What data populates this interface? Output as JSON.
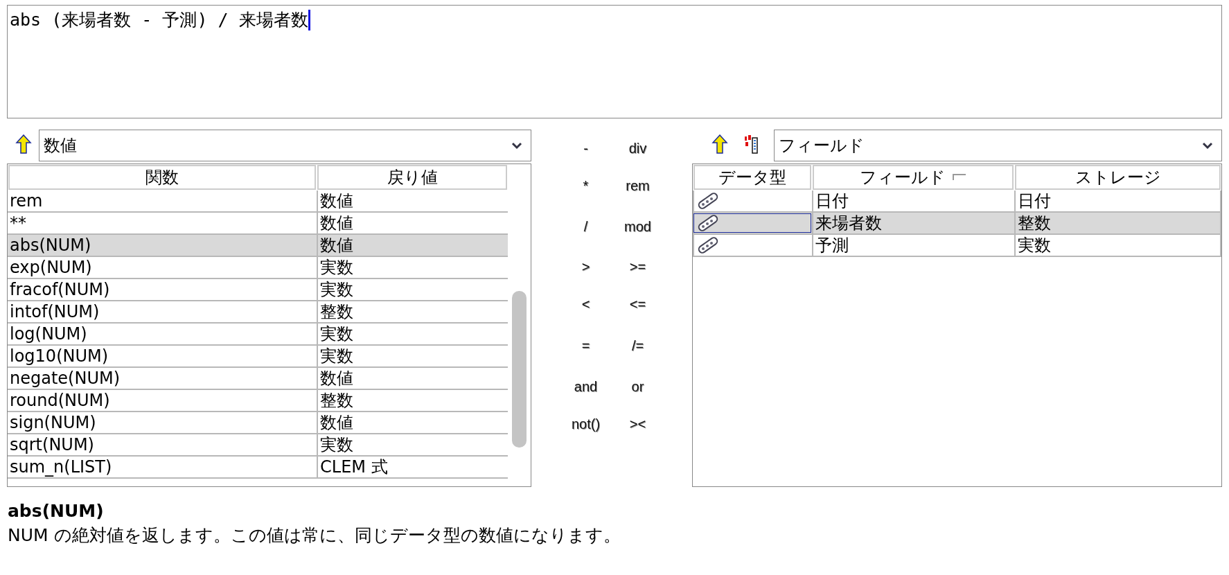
{
  "expression": {
    "value": "abs (来場者数 - 予測) / 来場者数"
  },
  "function_panel": {
    "category": {
      "value": "数値"
    },
    "columns": [
      "関数",
      "戻り値"
    ],
    "rows": [
      {
        "cells": [
          "rem",
          "数値"
        ],
        "selected": false
      },
      {
        "cells": [
          "**",
          "数値"
        ],
        "selected": false
      },
      {
        "cells": [
          "abs(NUM)",
          "数値"
        ],
        "selected": true
      },
      {
        "cells": [
          "exp(NUM)",
          "実数"
        ],
        "selected": false
      },
      {
        "cells": [
          "fracof(NUM)",
          "実数"
        ],
        "selected": false
      },
      {
        "cells": [
          "intof(NUM)",
          "整数"
        ],
        "selected": false
      },
      {
        "cells": [
          "log(NUM)",
          "実数"
        ],
        "selected": false
      },
      {
        "cells": [
          "log10(NUM)",
          "実数"
        ],
        "selected": false
      },
      {
        "cells": [
          "negate(NUM)",
          "数値"
        ],
        "selected": false
      },
      {
        "cells": [
          "round(NUM)",
          "整数"
        ],
        "selected": false
      },
      {
        "cells": [
          "sign(NUM)",
          "数値"
        ],
        "selected": false
      },
      {
        "cells": [
          "sqrt(NUM)",
          "実数"
        ],
        "selected": false
      },
      {
        "cells": [
          "sum_n(LIST)",
          "CLEM 式"
        ],
        "selected": false
      }
    ]
  },
  "operators": [
    "-",
    "div",
    "*",
    "rem",
    "/",
    "mod",
    ">",
    ">=",
    "<",
    "<=",
    "=",
    "/=",
    "and",
    "or",
    "not()",
    "><"
  ],
  "field_panel": {
    "field_list": {
      "value": "フィールド"
    },
    "columns": [
      {
        "label": "データ型",
        "sorted": false
      },
      {
        "label": "フィールド",
        "sorted": true
      },
      {
        "label": "ストレージ",
        "sorted": false
      }
    ],
    "rows": [
      {
        "cells": [
          "日付",
          "日付"
        ],
        "selected": false
      },
      {
        "cells": [
          "来場者数",
          "整数"
        ],
        "selected": true
      },
      {
        "cells": [
          "予測",
          "実数"
        ],
        "selected": false
      }
    ]
  },
  "description": {
    "title": "abs(NUM)",
    "text": "NUM の絶対値を返します。この値は常に、同じデータ型の数値になります。"
  }
}
